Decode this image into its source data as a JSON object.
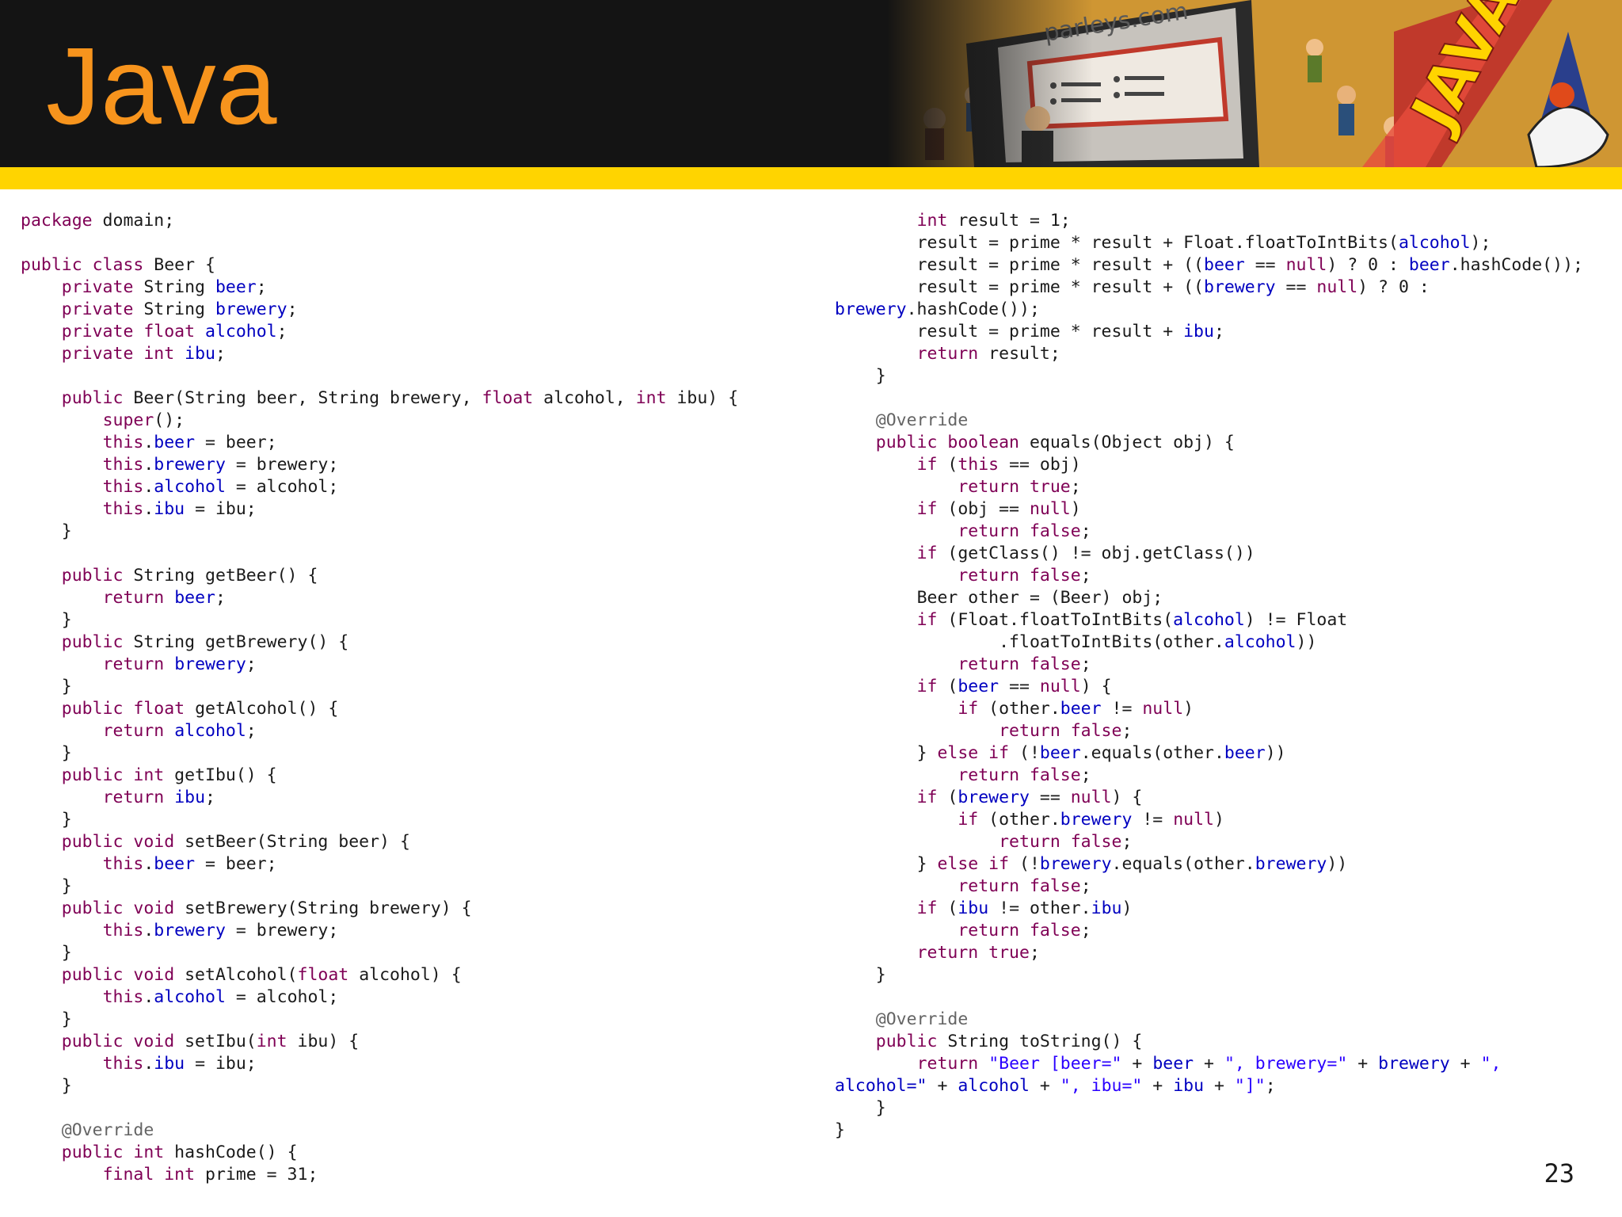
{
  "slide": {
    "title": "Java",
    "page_number": "23",
    "banner_text": "parleys.com",
    "banner_sign_text": "JAVA"
  },
  "colors": {
    "title": "#f7941d",
    "header_bg": "#141414",
    "stripe": "#ffd400",
    "keyword": "#7f0055",
    "field": "#0000c0",
    "annotation": "#646464",
    "string": "#2a00ff"
  },
  "code_left": [
    [
      [
        "kw",
        "package"
      ],
      [
        "t",
        " domain;"
      ]
    ],
    [],
    [
      [
        "kw",
        "public class"
      ],
      [
        "t",
        " Beer {"
      ]
    ],
    [
      [
        "t",
        "\t"
      ],
      [
        "kw",
        "private"
      ],
      [
        "t",
        " String "
      ],
      [
        "fd",
        "beer"
      ],
      [
        "t",
        ";"
      ]
    ],
    [
      [
        "t",
        "\t"
      ],
      [
        "kw",
        "private"
      ],
      [
        "t",
        " String "
      ],
      [
        "fd",
        "brewery"
      ],
      [
        "t",
        ";"
      ]
    ],
    [
      [
        "t",
        "\t"
      ],
      [
        "kw",
        "private float"
      ],
      [
        "t",
        " "
      ],
      [
        "fd",
        "alcohol"
      ],
      [
        "t",
        ";"
      ]
    ],
    [
      [
        "t",
        "\t"
      ],
      [
        "kw",
        "private int"
      ],
      [
        "t",
        " "
      ],
      [
        "fd",
        "ibu"
      ],
      [
        "t",
        ";"
      ]
    ],
    [],
    [
      [
        "t",
        "\t"
      ],
      [
        "kw",
        "public"
      ],
      [
        "t",
        " Beer(String beer, String brewery, "
      ],
      [
        "kw",
        "float"
      ],
      [
        "t",
        " alcohol, "
      ],
      [
        "kw",
        "int"
      ],
      [
        "t",
        " ibu) {"
      ]
    ],
    [
      [
        "t",
        "\t\t"
      ],
      [
        "kw",
        "super"
      ],
      [
        "t",
        "();"
      ]
    ],
    [
      [
        "t",
        "\t\t"
      ],
      [
        "kw",
        "this"
      ],
      [
        "t",
        "."
      ],
      [
        "fd",
        "beer"
      ],
      [
        "t",
        " = beer;"
      ]
    ],
    [
      [
        "t",
        "\t\t"
      ],
      [
        "kw",
        "this"
      ],
      [
        "t",
        "."
      ],
      [
        "fd",
        "brewery"
      ],
      [
        "t",
        " = brewery;"
      ]
    ],
    [
      [
        "t",
        "\t\t"
      ],
      [
        "kw",
        "this"
      ],
      [
        "t",
        "."
      ],
      [
        "fd",
        "alcohol"
      ],
      [
        "t",
        " = alcohol;"
      ]
    ],
    [
      [
        "t",
        "\t\t"
      ],
      [
        "kw",
        "this"
      ],
      [
        "t",
        "."
      ],
      [
        "fd",
        "ibu"
      ],
      [
        "t",
        " = ibu;"
      ]
    ],
    [
      [
        "t",
        "\t}"
      ]
    ],
    [],
    [
      [
        "t",
        "\t"
      ],
      [
        "kw",
        "public"
      ],
      [
        "t",
        " String getBeer() {"
      ]
    ],
    [
      [
        "t",
        "\t\t"
      ],
      [
        "kw",
        "return"
      ],
      [
        "t",
        " "
      ],
      [
        "fd",
        "beer"
      ],
      [
        "t",
        ";"
      ]
    ],
    [
      [
        "t",
        "\t}"
      ]
    ],
    [
      [
        "t",
        "\t"
      ],
      [
        "kw",
        "public"
      ],
      [
        "t",
        " String getBrewery() {"
      ]
    ],
    [
      [
        "t",
        "\t\t"
      ],
      [
        "kw",
        "return"
      ],
      [
        "t",
        " "
      ],
      [
        "fd",
        "brewery"
      ],
      [
        "t",
        ";"
      ]
    ],
    [
      [
        "t",
        "\t}"
      ]
    ],
    [
      [
        "t",
        "\t"
      ],
      [
        "kw",
        "public float"
      ],
      [
        "t",
        " getAlcohol() {"
      ]
    ],
    [
      [
        "t",
        "\t\t"
      ],
      [
        "kw",
        "return"
      ],
      [
        "t",
        " "
      ],
      [
        "fd",
        "alcohol"
      ],
      [
        "t",
        ";"
      ]
    ],
    [
      [
        "t",
        "\t}"
      ]
    ],
    [
      [
        "t",
        "\t"
      ],
      [
        "kw",
        "public int"
      ],
      [
        "t",
        " getIbu() {"
      ]
    ],
    [
      [
        "t",
        "\t\t"
      ],
      [
        "kw",
        "return"
      ],
      [
        "t",
        " "
      ],
      [
        "fd",
        "ibu"
      ],
      [
        "t",
        ";"
      ]
    ],
    [
      [
        "t",
        "\t}"
      ]
    ],
    [
      [
        "t",
        "\t"
      ],
      [
        "kw",
        "public void"
      ],
      [
        "t",
        " setBeer(String beer) {"
      ]
    ],
    [
      [
        "t",
        "\t\t"
      ],
      [
        "kw",
        "this"
      ],
      [
        "t",
        "."
      ],
      [
        "fd",
        "beer"
      ],
      [
        "t",
        " = beer;"
      ]
    ],
    [
      [
        "t",
        "\t}"
      ]
    ],
    [
      [
        "t",
        "\t"
      ],
      [
        "kw",
        "public void"
      ],
      [
        "t",
        " setBrewery(String brewery) {"
      ]
    ],
    [
      [
        "t",
        "\t\t"
      ],
      [
        "kw",
        "this"
      ],
      [
        "t",
        "."
      ],
      [
        "fd",
        "brewery"
      ],
      [
        "t",
        " = brewery;"
      ]
    ],
    [
      [
        "t",
        "\t}"
      ]
    ],
    [
      [
        "t",
        "\t"
      ],
      [
        "kw",
        "public void"
      ],
      [
        "t",
        " setAlcohol("
      ],
      [
        "kw",
        "float"
      ],
      [
        "t",
        " alcohol) {"
      ]
    ],
    [
      [
        "t",
        "\t\t"
      ],
      [
        "kw",
        "this"
      ],
      [
        "t",
        "."
      ],
      [
        "fd",
        "alcohol"
      ],
      [
        "t",
        " = alcohol;"
      ]
    ],
    [
      [
        "t",
        "\t}"
      ]
    ],
    [
      [
        "t",
        "\t"
      ],
      [
        "kw",
        "public void"
      ],
      [
        "t",
        " setIbu("
      ],
      [
        "kw",
        "int"
      ],
      [
        "t",
        " ibu) {"
      ]
    ],
    [
      [
        "t",
        "\t\t"
      ],
      [
        "kw",
        "this"
      ],
      [
        "t",
        "."
      ],
      [
        "fd",
        "ibu"
      ],
      [
        "t",
        " = ibu;"
      ]
    ],
    [
      [
        "t",
        "\t}"
      ]
    ],
    [],
    [
      [
        "t",
        "\t"
      ],
      [
        "an",
        "@Override"
      ]
    ],
    [
      [
        "t",
        "\t"
      ],
      [
        "kw",
        "public int"
      ],
      [
        "t",
        " hashCode() {"
      ]
    ],
    [
      [
        "t",
        "\t\t"
      ],
      [
        "kw",
        "final int"
      ],
      [
        "t",
        " prime = 31;"
      ]
    ]
  ],
  "code_right": [
    [
      [
        "t",
        "\t\t"
      ],
      [
        "kw",
        "int"
      ],
      [
        "t",
        " result = 1;"
      ]
    ],
    [
      [
        "t",
        "\t\tresult = prime * result + Float.floatToIntBits("
      ],
      [
        "fd",
        "alcohol"
      ],
      [
        "t",
        ");"
      ]
    ],
    [
      [
        "t",
        "\t\tresult = prime * result + (("
      ],
      [
        "fd",
        "beer"
      ],
      [
        "t",
        " == "
      ],
      [
        "kw",
        "null"
      ],
      [
        "t",
        ") ? 0 : "
      ],
      [
        "fd",
        "beer"
      ],
      [
        "t",
        ".hashCode());"
      ]
    ],
    [
      [
        "t",
        "\t\tresult = prime * result + (("
      ],
      [
        "fd",
        "brewery"
      ],
      [
        "t",
        " == "
      ],
      [
        "kw",
        "null"
      ],
      [
        "t",
        ") ? 0 :"
      ]
    ],
    [
      [
        "fd",
        "brewery"
      ],
      [
        "t",
        ".hashCode());"
      ]
    ],
    [
      [
        "t",
        "\t\tresult = prime * result + "
      ],
      [
        "fd",
        "ibu"
      ],
      [
        "t",
        ";"
      ]
    ],
    [
      [
        "t",
        "\t\t"
      ],
      [
        "kw",
        "return"
      ],
      [
        "t",
        " result;"
      ]
    ],
    [
      [
        "t",
        "\t}"
      ]
    ],
    [],
    [
      [
        "t",
        "\t"
      ],
      [
        "an",
        "@Override"
      ]
    ],
    [
      [
        "t",
        "\t"
      ],
      [
        "kw",
        "public boolean"
      ],
      [
        "t",
        " equals(Object obj) {"
      ]
    ],
    [
      [
        "t",
        "\t\t"
      ],
      [
        "kw",
        "if"
      ],
      [
        "t",
        " ("
      ],
      [
        "kw",
        "this"
      ],
      [
        "t",
        " == obj)"
      ]
    ],
    [
      [
        "t",
        "\t\t\t"
      ],
      [
        "kw",
        "return true"
      ],
      [
        "t",
        ";"
      ]
    ],
    [
      [
        "t",
        "\t\t"
      ],
      [
        "kw",
        "if"
      ],
      [
        "t",
        " (obj == "
      ],
      [
        "kw",
        "null"
      ],
      [
        "t",
        ")"
      ]
    ],
    [
      [
        "t",
        "\t\t\t"
      ],
      [
        "kw",
        "return false"
      ],
      [
        "t",
        ";"
      ]
    ],
    [
      [
        "t",
        "\t\t"
      ],
      [
        "kw",
        "if"
      ],
      [
        "t",
        " (getClass() != obj.getClass())"
      ]
    ],
    [
      [
        "t",
        "\t\t\t"
      ],
      [
        "kw",
        "return false"
      ],
      [
        "t",
        ";"
      ]
    ],
    [
      [
        "t",
        "\t\tBeer other = (Beer) obj;"
      ]
    ],
    [
      [
        "t",
        "\t\t"
      ],
      [
        "kw",
        "if"
      ],
      [
        "t",
        " (Float.floatToIntBits("
      ],
      [
        "fd",
        "alcohol"
      ],
      [
        "t",
        ") != Float"
      ]
    ],
    [
      [
        "t",
        "\t\t\t\t.floatToIntBits(other."
      ],
      [
        "fd",
        "alcohol"
      ],
      [
        "t",
        "))"
      ]
    ],
    [
      [
        "t",
        "\t\t\t"
      ],
      [
        "kw",
        "return false"
      ],
      [
        "t",
        ";"
      ]
    ],
    [
      [
        "t",
        "\t\t"
      ],
      [
        "kw",
        "if"
      ],
      [
        "t",
        " ("
      ],
      [
        "fd",
        "beer"
      ],
      [
        "t",
        " == "
      ],
      [
        "kw",
        "null"
      ],
      [
        "t",
        ") {"
      ]
    ],
    [
      [
        "t",
        "\t\t\t"
      ],
      [
        "kw",
        "if"
      ],
      [
        "t",
        " (other."
      ],
      [
        "fd",
        "beer"
      ],
      [
        "t",
        " != "
      ],
      [
        "kw",
        "null"
      ],
      [
        "t",
        ")"
      ]
    ],
    [
      [
        "t",
        "\t\t\t\t"
      ],
      [
        "kw",
        "return false"
      ],
      [
        "t",
        ";"
      ]
    ],
    [
      [
        "t",
        "\t\t} "
      ],
      [
        "kw",
        "else if"
      ],
      [
        "t",
        " (!"
      ],
      [
        "fd",
        "beer"
      ],
      [
        "t",
        ".equals(other."
      ],
      [
        "fd",
        "beer"
      ],
      [
        "t",
        "))"
      ]
    ],
    [
      [
        "t",
        "\t\t\t"
      ],
      [
        "kw",
        "return false"
      ],
      [
        "t",
        ";"
      ]
    ],
    [
      [
        "t",
        "\t\t"
      ],
      [
        "kw",
        "if"
      ],
      [
        "t",
        " ("
      ],
      [
        "fd",
        "brewery"
      ],
      [
        "t",
        " == "
      ],
      [
        "kw",
        "null"
      ],
      [
        "t",
        ") {"
      ]
    ],
    [
      [
        "t",
        "\t\t\t"
      ],
      [
        "kw",
        "if"
      ],
      [
        "t",
        " (other."
      ],
      [
        "fd",
        "brewery"
      ],
      [
        "t",
        " != "
      ],
      [
        "kw",
        "null"
      ],
      [
        "t",
        ")"
      ]
    ],
    [
      [
        "t",
        "\t\t\t\t"
      ],
      [
        "kw",
        "return false"
      ],
      [
        "t",
        ";"
      ]
    ],
    [
      [
        "t",
        "\t\t} "
      ],
      [
        "kw",
        "else if"
      ],
      [
        "t",
        " (!"
      ],
      [
        "fd",
        "brewery"
      ],
      [
        "t",
        ".equals(other."
      ],
      [
        "fd",
        "brewery"
      ],
      [
        "t",
        "))"
      ]
    ],
    [
      [
        "t",
        "\t\t\t"
      ],
      [
        "kw",
        "return false"
      ],
      [
        "t",
        ";"
      ]
    ],
    [
      [
        "t",
        "\t\t"
      ],
      [
        "kw",
        "if"
      ],
      [
        "t",
        " ("
      ],
      [
        "fd",
        "ibu"
      ],
      [
        "t",
        " != other."
      ],
      [
        "fd",
        "ibu"
      ],
      [
        "t",
        ")"
      ]
    ],
    [
      [
        "t",
        "\t\t\t"
      ],
      [
        "kw",
        "return false"
      ],
      [
        "t",
        ";"
      ]
    ],
    [
      [
        "t",
        "\t\t"
      ],
      [
        "kw",
        "return true"
      ],
      [
        "t",
        ";"
      ]
    ],
    [
      [
        "t",
        "\t}"
      ]
    ],
    [],
    [
      [
        "t",
        "\t"
      ],
      [
        "an",
        "@Override"
      ]
    ],
    [
      [
        "t",
        "\t"
      ],
      [
        "kw",
        "public"
      ],
      [
        "t",
        " String toString() {"
      ]
    ],
    [
      [
        "t",
        "\t\t"
      ],
      [
        "kw",
        "return"
      ],
      [
        "t",
        " "
      ],
      [
        "st",
        "\"Beer [beer=\""
      ],
      [
        "t",
        " + "
      ],
      [
        "fd",
        "beer"
      ],
      [
        "t",
        " + "
      ],
      [
        "st",
        "\", brewery=\""
      ],
      [
        "t",
        " + "
      ],
      [
        "fd",
        "brewery"
      ],
      [
        "t",
        " + "
      ],
      [
        "st",
        "\","
      ]
    ],
    [
      [
        "fd",
        "alcohol=\""
      ],
      [
        "t",
        " + "
      ],
      [
        "fd",
        "alcohol"
      ],
      [
        "t",
        " + "
      ],
      [
        "st",
        "\", ibu=\""
      ],
      [
        "t",
        " + "
      ],
      [
        "fd",
        "ibu"
      ],
      [
        "t",
        " + "
      ],
      [
        "st",
        "\"]\""
      ],
      [
        "t",
        ";"
      ]
    ],
    [
      [
        "t",
        "\t}"
      ]
    ],
    [
      [
        "t",
        "}"
      ]
    ]
  ]
}
